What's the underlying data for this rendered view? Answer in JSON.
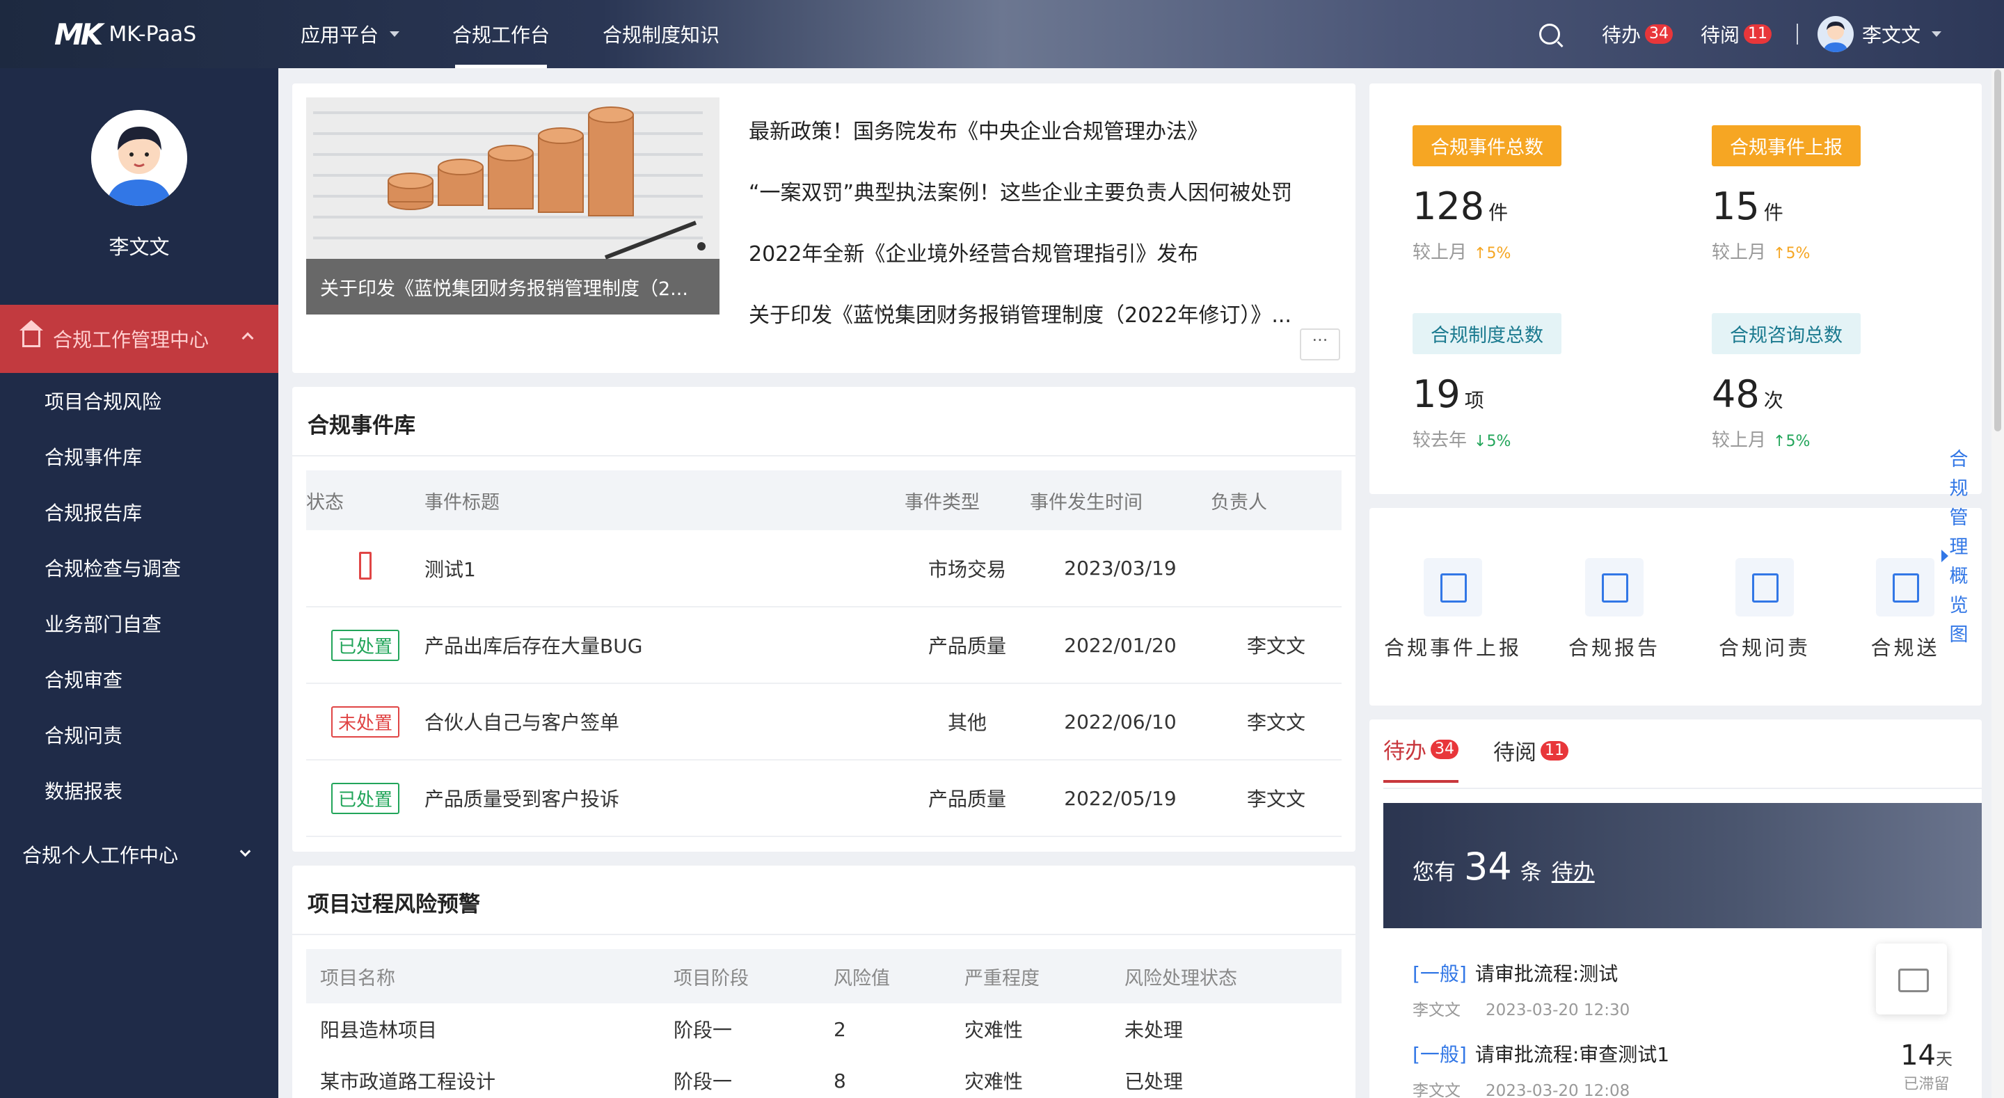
{
  "header": {
    "logo_mark": "MK",
    "logo_text": "MK-PaaS",
    "nav": [
      {
        "label": "应用平台"
      },
      {
        "label": "合规工作台"
      },
      {
        "label": "合规制度知识"
      }
    ],
    "todo_label": "待办",
    "todo_count": "34",
    "read_label": "待阅",
    "read_count": "11",
    "user_name": "李文文"
  },
  "sidebar": {
    "user_name": "李文文",
    "group1_label": "合规工作管理中心",
    "items": [
      {
        "label": "项目合规风险"
      },
      {
        "label": "合规事件库"
      },
      {
        "label": "合规报告库"
      },
      {
        "label": "合规检查与调查"
      },
      {
        "label": "业务部门自查"
      },
      {
        "label": "合规审查"
      },
      {
        "label": "合规问责"
      },
      {
        "label": "数据报表"
      }
    ],
    "group2_label": "合规个人工作中心"
  },
  "news": {
    "caption": "关于印发《蓝悦集团财务报销管理制度（2...",
    "items": [
      "最新政策！国务院发布《中央企业合规管理办法》",
      "“一案双罚”典型执法案例！这些企业主要负责人因何被处罚",
      "2022年全新《企业境外经营合规管理指引》发布",
      "关于印发《蓝悦集团财务报销管理制度（2022年修订）》..."
    ],
    "more": "···"
  },
  "events": {
    "title": "合规事件库",
    "columns": [
      "状态",
      "事件标题",
      "事件类型",
      "事件发生时间",
      "负责人"
    ],
    "rows": [
      {
        "status": "",
        "title": "测试1",
        "type": "市场交易",
        "date": "2023/03/19",
        "owner": ""
      },
      {
        "status": "已处置",
        "title": "产品出库后存在大量BUG",
        "type": "产品质量",
        "date": "2022/01/20",
        "owner": "李文文"
      },
      {
        "status": "未处置",
        "title": "合伙人自己与客户签单",
        "type": "其他",
        "date": "2022/06/10",
        "owner": "李文文"
      },
      {
        "status": "已处置",
        "title": "产品质量受到客户投诉",
        "type": "产品质量",
        "date": "2022/05/19",
        "owner": "李文文"
      }
    ]
  },
  "risk": {
    "title": "项目过程风险预警",
    "columns": [
      "项目名称",
      "项目阶段",
      "风险值",
      "严重程度",
      "风险处理状态"
    ],
    "rows": [
      {
        "name": "阳县造林项目",
        "stage": "阶段一",
        "value": "2",
        "severity": "灾难性",
        "state": "未处理"
      },
      {
        "name": "某市政道路工程设计",
        "stage": "阶段一",
        "value": "8",
        "severity": "灾难性",
        "state": "已处理"
      }
    ]
  },
  "stats": [
    {
      "label": "合规事件总数",
      "num": "128",
      "unit": "件",
      "cmp": "较上月",
      "trend": "↑5%"
    },
    {
      "label": "合规事件上报",
      "num": "15",
      "unit": "件",
      "cmp": "较上月",
      "trend": "↑5%"
    },
    {
      "label": "合规制度总数",
      "num": "19",
      "unit": "项",
      "cmp": "较去年",
      "trend": "↓5%"
    },
    {
      "label": "合规咨询总数",
      "num": "48",
      "unit": "次",
      "cmp": "较上月",
      "trend": "↑5%"
    }
  ],
  "quick": [
    {
      "label": "合规事件上报"
    },
    {
      "label": "合规报告"
    },
    {
      "label": "合规问责"
    },
    {
      "label": "合规送"
    }
  ],
  "side_tab": "合规管理概览图",
  "todo": {
    "tab_todo": "待办",
    "tab_todo_count": "34",
    "tab_read": "待阅",
    "tab_read_count": "11",
    "banner_prefix": "您有",
    "banner_count": "34",
    "banner_unit": "条",
    "banner_link": "待办",
    "items": [
      {
        "tag": "[一般]",
        "title": "请审批流程:测试",
        "user": "李文文",
        "time": "2023-03-20 12:30",
        "days": "",
        "days_unit": "",
        "stay": ""
      },
      {
        "tag": "[一般]",
        "title": "请审批流程:审查测试1",
        "user": "李文文",
        "time": "2023-03-20 12:08",
        "days": "14",
        "days_unit": "天",
        "stay": "已滞留"
      }
    ]
  },
  "colors": {
    "accent_red": "#c8373d",
    "brand_blue": "#3277e6",
    "sidebar_bg": "#1f2b48",
    "orange": "#f6a623"
  }
}
